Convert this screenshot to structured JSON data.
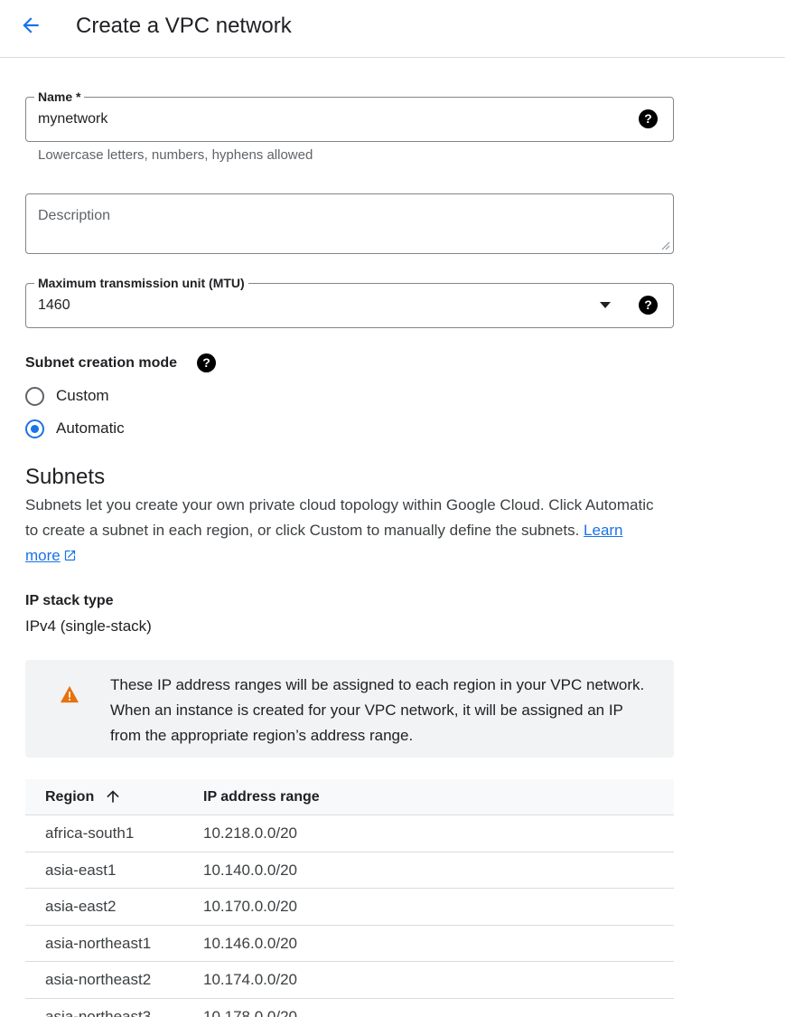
{
  "header": {
    "title": "Create a VPC network",
    "back_icon": "arrow-back-icon"
  },
  "name_field": {
    "label": "Name *",
    "value": "mynetwork",
    "hint": "Lowercase letters, numbers, hyphens allowed",
    "help_glyph": "?"
  },
  "description_field": {
    "placeholder": "Description"
  },
  "mtu_field": {
    "label": "Maximum transmission unit (MTU)",
    "value": "1460",
    "help_glyph": "?"
  },
  "subnet_mode": {
    "label": "Subnet creation mode",
    "help_glyph": "?",
    "options": [
      {
        "label": "Custom",
        "selected": false
      },
      {
        "label": "Automatic",
        "selected": true
      }
    ]
  },
  "subnets": {
    "title": "Subnets",
    "description": "Subnets let you create your own private cloud topology within Google Cloud. Click Automatic to create a subnet in each region, or click Custom to manually define the subnets.",
    "learn_more": "Learn more"
  },
  "ip_stack": {
    "label": "IP stack type",
    "value": "IPv4 (single-stack)"
  },
  "warning": {
    "text": "These IP address ranges will be assigned to each region in your VPC network. When an instance is created for your VPC network, it will be assigned an IP from the appropriate region’s address range.",
    "color": "#e8710a"
  },
  "table": {
    "columns": [
      "Region",
      "IP address range"
    ],
    "rows": [
      {
        "region": "africa-south1",
        "range": "10.218.0.0/20"
      },
      {
        "region": "asia-east1",
        "range": "10.140.0.0/20"
      },
      {
        "region": "asia-east2",
        "range": "10.170.0.0/20"
      },
      {
        "region": "asia-northeast1",
        "range": "10.146.0.0/20"
      },
      {
        "region": "asia-northeast2",
        "range": "10.174.0.0/20"
      },
      {
        "region": "asia-northeast3",
        "range": "10.178.0.0/20"
      }
    ]
  },
  "colors": {
    "accent": "#1a73e8",
    "warning": "#e8710a"
  }
}
